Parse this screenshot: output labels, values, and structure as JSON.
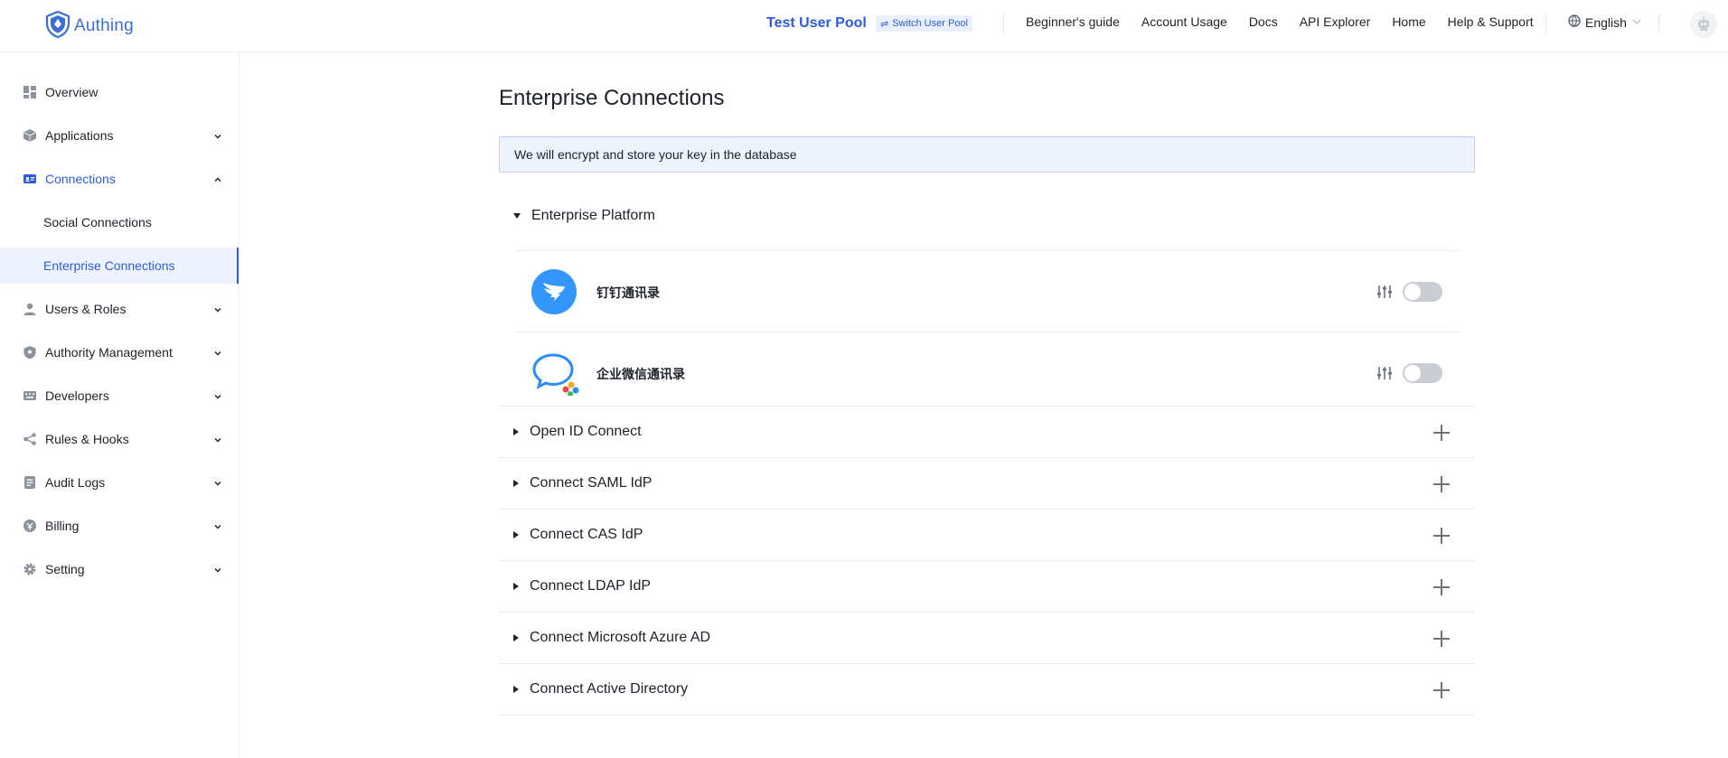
{
  "header": {
    "logo_text": "Authing",
    "pool_name": "Test User Pool",
    "switch_label": "Switch User Pool",
    "nav": [
      "Beginner's guide",
      "Account Usage",
      "Docs",
      "API Explorer",
      "Home",
      "Help & Support"
    ],
    "language": "English"
  },
  "sidebar": {
    "items": [
      {
        "label": "Overview",
        "icon": "dashboard-icon"
      },
      {
        "label": "Applications",
        "icon": "cube-icon"
      },
      {
        "label": "Connections",
        "icon": "id-card-icon"
      },
      {
        "label": "Users & Roles",
        "icon": "user-icon"
      },
      {
        "label": "Authority Management",
        "icon": "shield-icon"
      },
      {
        "label": "Developers",
        "icon": "keyboard-icon"
      },
      {
        "label": "Rules & Hooks",
        "icon": "share-icon"
      },
      {
        "label": "Audit Logs",
        "icon": "log-icon"
      },
      {
        "label": "Billing",
        "icon": "billing-icon"
      },
      {
        "label": "Setting",
        "icon": "gear-icon"
      }
    ],
    "connections_sub": [
      "Social Connections",
      "Enterprise Connections"
    ]
  },
  "main": {
    "title": "Enterprise Connections",
    "notice": "We will encrypt and store your key in the database",
    "platform_section": "Enterprise Platform",
    "platforms": [
      {
        "name": "钉钉通讯录",
        "enabled": false
      },
      {
        "name": "企业微信通讯录",
        "enabled": false
      }
    ],
    "sections": [
      "Open ID Connect",
      "Connect SAML IdP",
      "Connect CAS IdP",
      "Connect LDAP IdP",
      "Connect Microsoft Azure AD",
      "Connect Active Directory"
    ]
  },
  "colors": {
    "accent": "#2d5bd9",
    "notice_bg": "#eef4fd",
    "notice_border": "#b9d1f5",
    "toggle_off": "#c9cdd4",
    "dingtalk": "#3296fa"
  }
}
